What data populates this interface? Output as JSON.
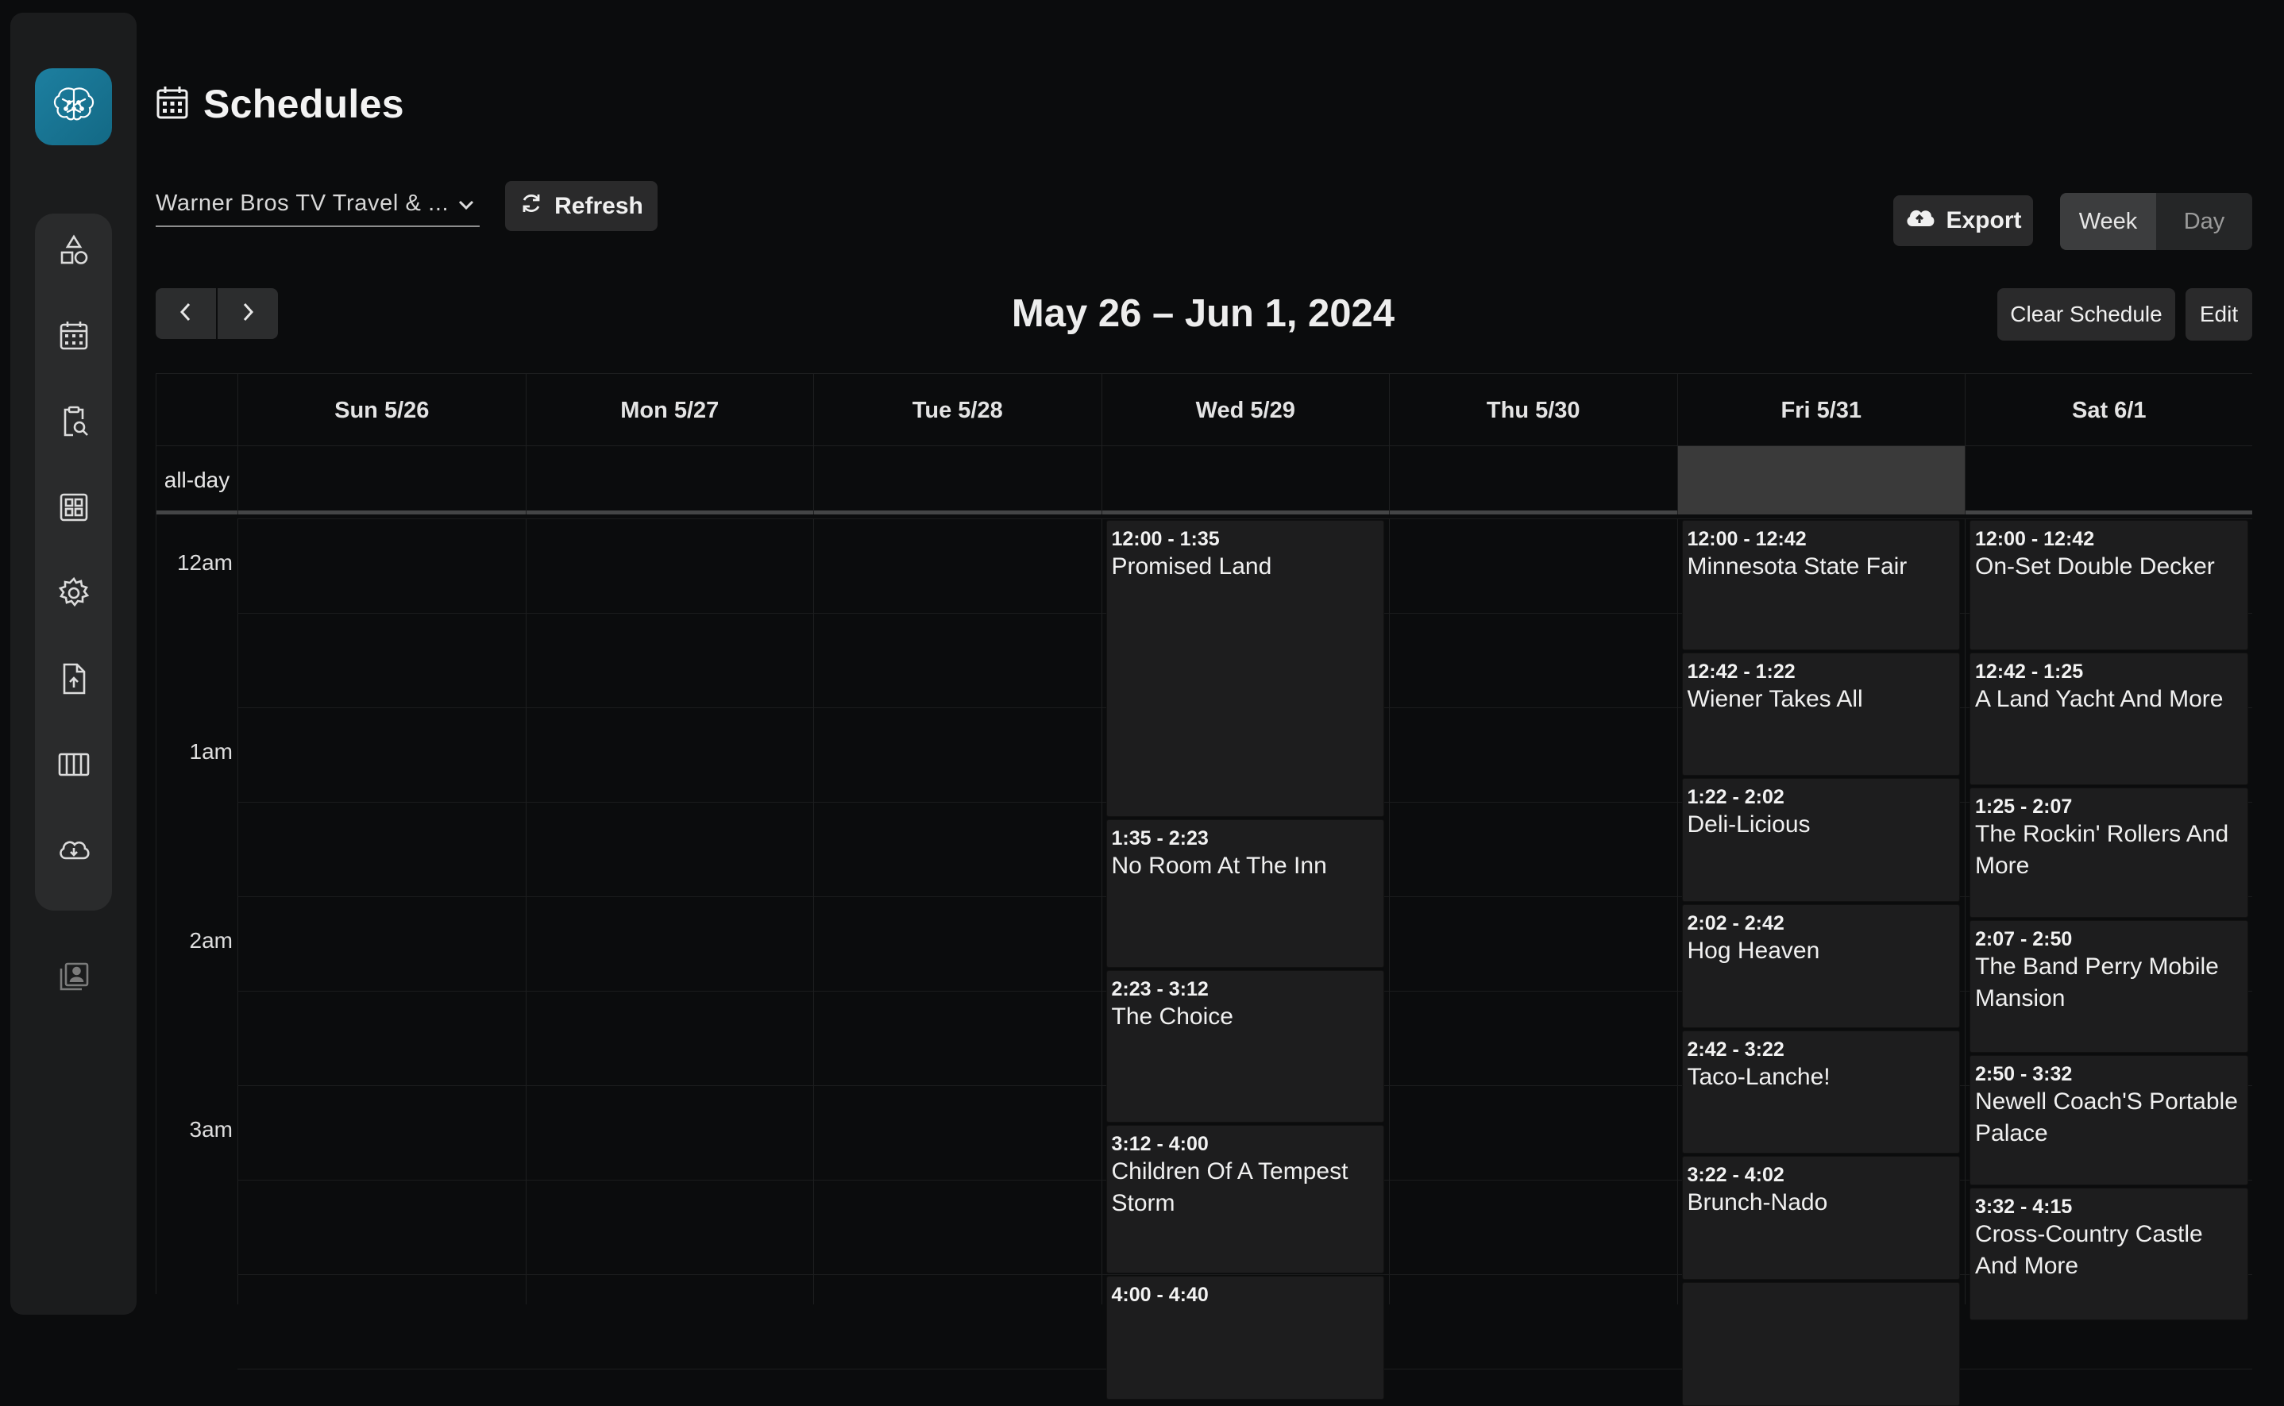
{
  "page": {
    "title": "Schedules",
    "title_icon": "calendar-icon"
  },
  "sidebar": {
    "logo_icon": "brain-icon",
    "items": [
      {
        "icon": "shapes-icon"
      },
      {
        "icon": "calendar-icon"
      },
      {
        "icon": "clipboard-search-icon"
      },
      {
        "icon": "grid-icon"
      },
      {
        "icon": "gear-icon"
      },
      {
        "icon": "file-upload-icon"
      },
      {
        "icon": "columns-icon"
      },
      {
        "icon": "cloud-download-icon"
      }
    ],
    "extra_icon": "library-icon"
  },
  "toolbar": {
    "schedule_value": "Warner Bros TV Travel & ...",
    "refresh_label": "Refresh",
    "export_label": "Export",
    "week_label": "Week",
    "day_label": "Day",
    "clear_label": "Clear Schedule",
    "edit_label": "Edit",
    "range_title": "May 26 – Jun 1, 2024"
  },
  "calendar": {
    "days": [
      "Sun 5/26",
      "Mon 5/27",
      "Tue 5/28",
      "Wed 5/29",
      "Thu 5/30",
      "Fri 5/31",
      "Sat 6/1"
    ],
    "today_day": "Fri 5/31",
    "allday_label": "all-day",
    "hours": [
      "12am",
      "1am",
      "2am",
      "3am"
    ],
    "events": [
      {
        "day": 3,
        "start": "0:00",
        "end": "1:35",
        "time": "12:00 - 1:35",
        "title": "Promised Land"
      },
      {
        "day": 3,
        "start": "1:35",
        "end": "2:23",
        "time": "1:35 - 2:23",
        "title": "No Room At The Inn"
      },
      {
        "day": 3,
        "start": "2:23",
        "end": "3:12",
        "time": "2:23 - 3:12",
        "title": "The Choice"
      },
      {
        "day": 3,
        "start": "3:12",
        "end": "4:00",
        "time": "3:12 - 4:00",
        "title": "Children Of A Tempest Storm"
      },
      {
        "day": 3,
        "start": "4:00",
        "end": "4:40",
        "time": "4:00 - 4:40",
        "title": ""
      },
      {
        "day": 5,
        "start": "0:00",
        "end": "0:42",
        "time": "12:00 - 12:42",
        "title": "Minnesota State Fair"
      },
      {
        "day": 5,
        "start": "0:42",
        "end": "1:22",
        "time": "12:42 - 1:22",
        "title": "Wiener Takes All"
      },
      {
        "day": 5,
        "start": "1:22",
        "end": "2:02",
        "time": "1:22 - 2:02",
        "title": "Deli-Licious"
      },
      {
        "day": 5,
        "start": "2:02",
        "end": "2:42",
        "time": "2:02 - 2:42",
        "title": "Hog Heaven"
      },
      {
        "day": 5,
        "start": "2:42",
        "end": "3:22",
        "time": "2:42 - 3:22",
        "title": "Taco-Lanche!"
      },
      {
        "day": 5,
        "start": "3:22",
        "end": "4:02",
        "time": "3:22 - 4:02",
        "title": "Brunch-Nado"
      },
      {
        "day": 5,
        "start": "4:02",
        "end": "4:42",
        "time": "",
        "title": ""
      },
      {
        "day": 6,
        "start": "0:00",
        "end": "0:42",
        "time": "12:00 - 12:42",
        "title": "On-Set Double Decker"
      },
      {
        "day": 6,
        "start": "0:42",
        "end": "1:25",
        "time": "12:42 - 1:25",
        "title": "A Land Yacht And More"
      },
      {
        "day": 6,
        "start": "1:25",
        "end": "2:07",
        "time": "1:25 - 2:07",
        "title": "The Rockin' Rollers And More"
      },
      {
        "day": 6,
        "start": "2:07",
        "end": "2:50",
        "time": "2:07 - 2:50",
        "title": "The Band Perry Mobile Mansion"
      },
      {
        "day": 6,
        "start": "2:50",
        "end": "3:32",
        "time": "2:50 - 3:32",
        "title": "Newell Coach'S Portable Palace"
      },
      {
        "day": 6,
        "start": "3:32",
        "end": "4:15",
        "time": "3:32 - 4:15",
        "title": "Cross-Country Castle And More"
      }
    ]
  }
}
